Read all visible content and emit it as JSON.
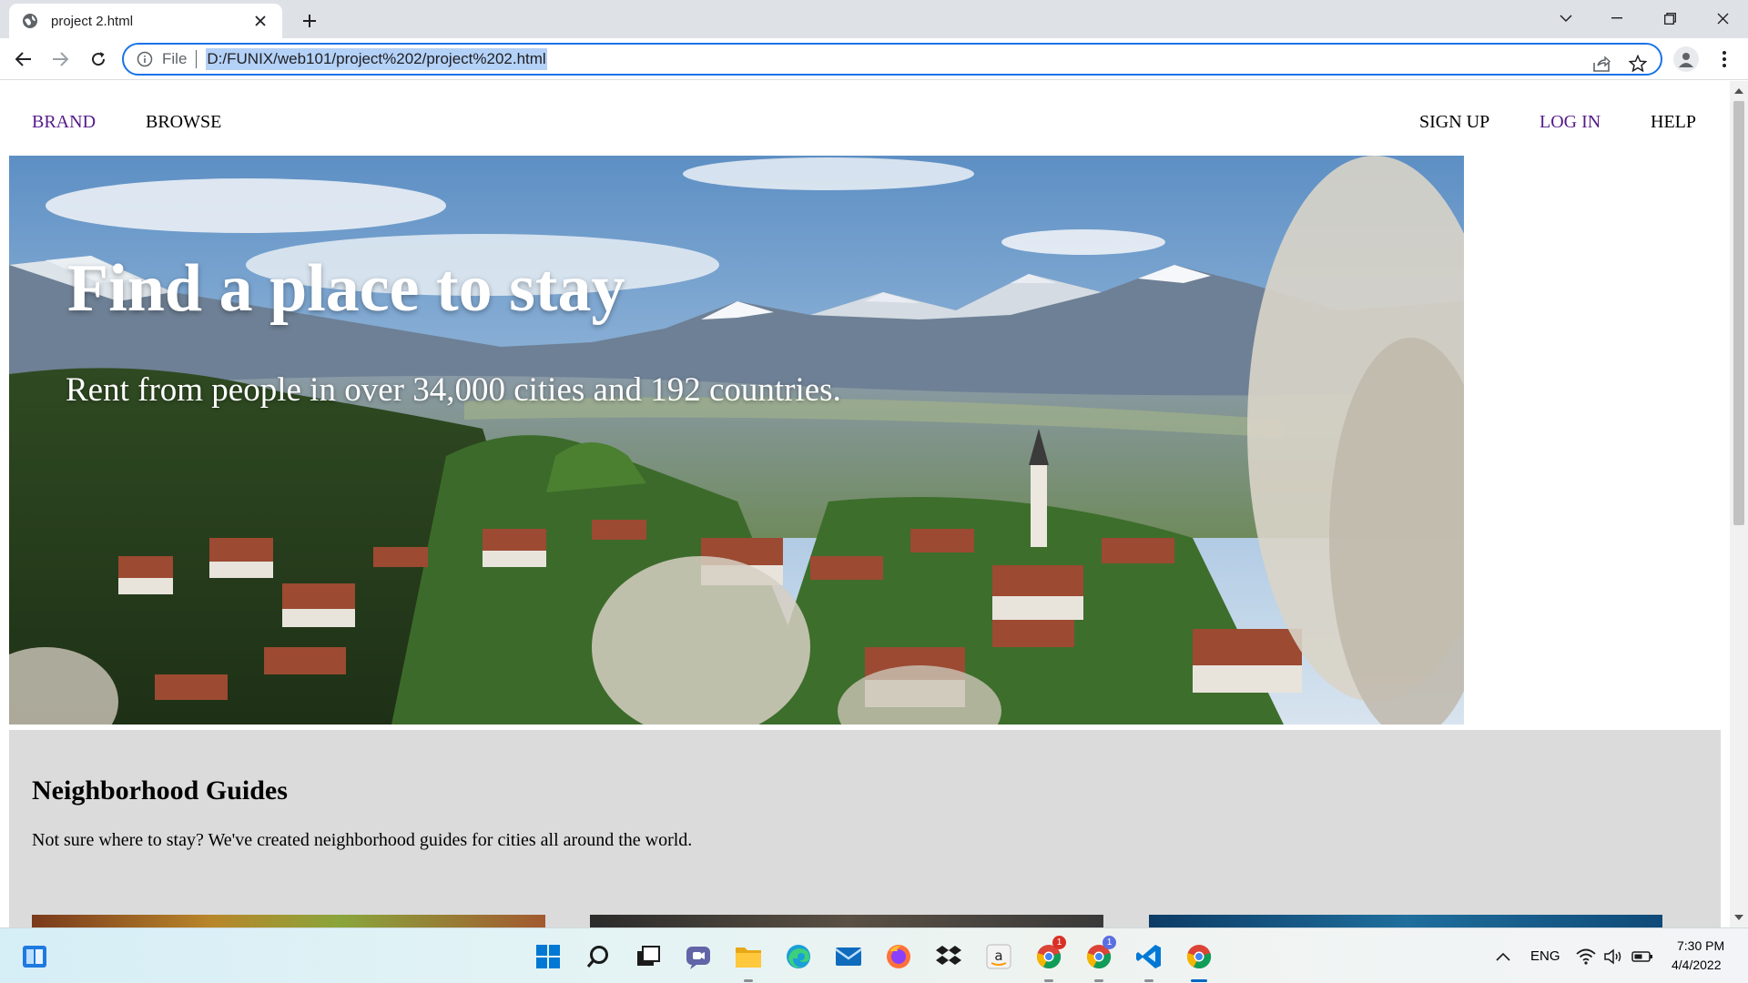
{
  "browser": {
    "tab_title": "project 2.html",
    "url_scheme": "File",
    "url": "D:/FUNIX/web101/project%202/project%202.html"
  },
  "site": {
    "nav": {
      "brand": "BRAND",
      "browse": "BROWSE",
      "sign_up": "SIGN UP",
      "log_in": "LOG IN",
      "help": "HELP"
    },
    "hero": {
      "title": "Find a place to stay",
      "subtitle": "Rent from people in over 34,000 cities and 192 countries."
    },
    "guides": {
      "title": "Neighborhood Guides",
      "text": "Not sure where to stay? We've created neighborhood guides for cities all around the world."
    }
  },
  "taskbar": {
    "language": "ENG",
    "time": "7:30 PM",
    "date": "4/4/2022",
    "chrome_badge_1": "1",
    "chrome_badge_2": "1"
  },
  "colors": {
    "accent": "#1a73e8",
    "visited_link": "#551a8b",
    "guides_bg": "#dbdbdb"
  }
}
